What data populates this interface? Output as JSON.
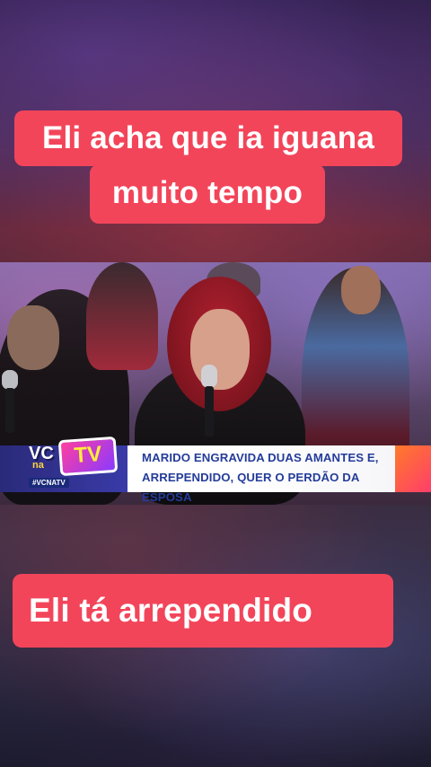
{
  "captions": {
    "top_line1": "Eli acha que ia iguana",
    "top_line2": "muito tempo",
    "bottom": "Eli tá arrependido"
  },
  "broadcast": {
    "logo_vc": "VC",
    "logo_na": "na",
    "logo_tv": "TV",
    "hashtag": "#VCNATV",
    "headline_line1": "MARIDO ENGRAVIDA DUAS AMANTES E,",
    "headline_line2": "ARREPENDIDO, QUER O PERDÃO DA ESPOSA"
  },
  "colors": {
    "caption_bg": "#f2455a",
    "caption_text": "#ffffff",
    "headline_text": "#243c9a",
    "brand_blue": "#2a2a7a"
  }
}
